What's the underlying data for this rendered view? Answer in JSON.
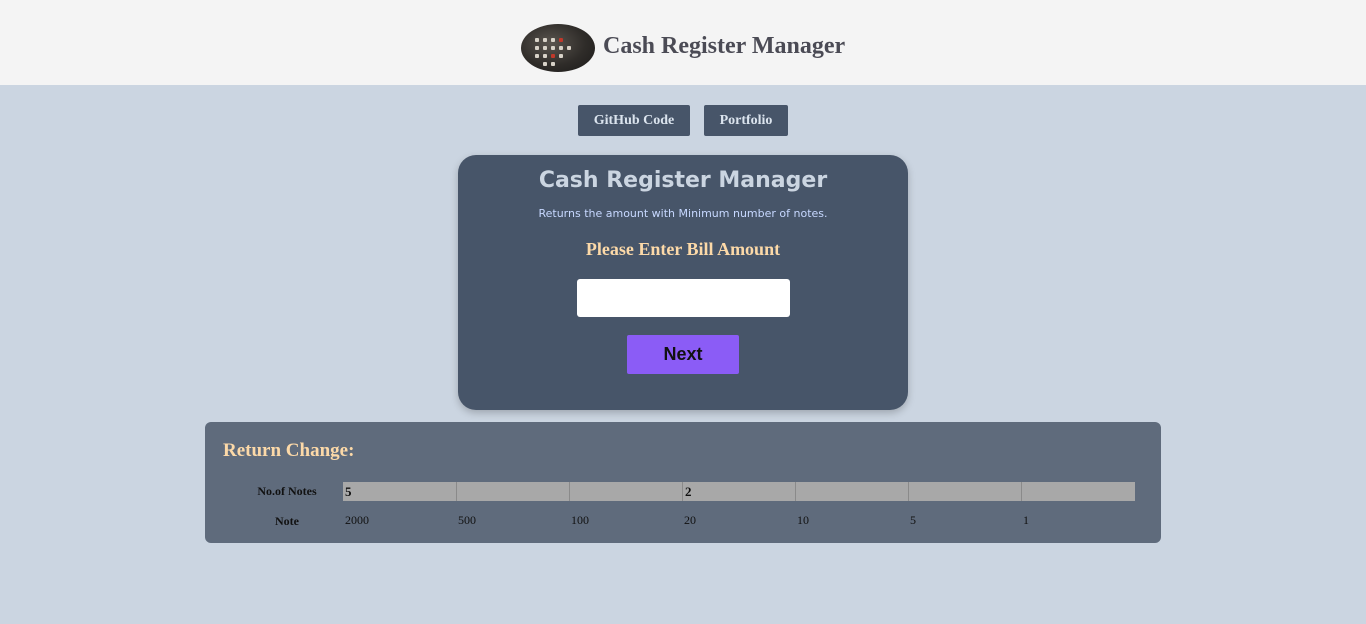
{
  "header": {
    "title": "Cash Register Manager",
    "logo_icon": "cash-register-icon"
  },
  "nav": {
    "github_label": "GitHub Code",
    "portfolio_label": "Portfolio"
  },
  "card": {
    "title": "Cash Register Manager",
    "subtitle": "Returns the amount with Minimum number of notes.",
    "prompt": "Please Enter Bill Amount",
    "bill_input_value": "",
    "bill_input_placeholder": "",
    "next_label": "Next"
  },
  "result": {
    "title": "Return Change:",
    "count_label": "No.of Notes",
    "note_label": "Note",
    "counts": [
      "5",
      "",
      "",
      "2",
      "",
      "",
      ""
    ],
    "notes": [
      "2000",
      "500",
      "100",
      "20",
      "10",
      "5",
      "1"
    ]
  },
  "colors": {
    "background": "#cbd5e1",
    "header_bg": "#f4f4f4",
    "card_bg": "#475569",
    "accent_button": "#8b5cf6",
    "prompt_text": "#fcd9a8",
    "result_bg": "#5f6b7c",
    "count_cell_bg": "#a8a8a8"
  }
}
